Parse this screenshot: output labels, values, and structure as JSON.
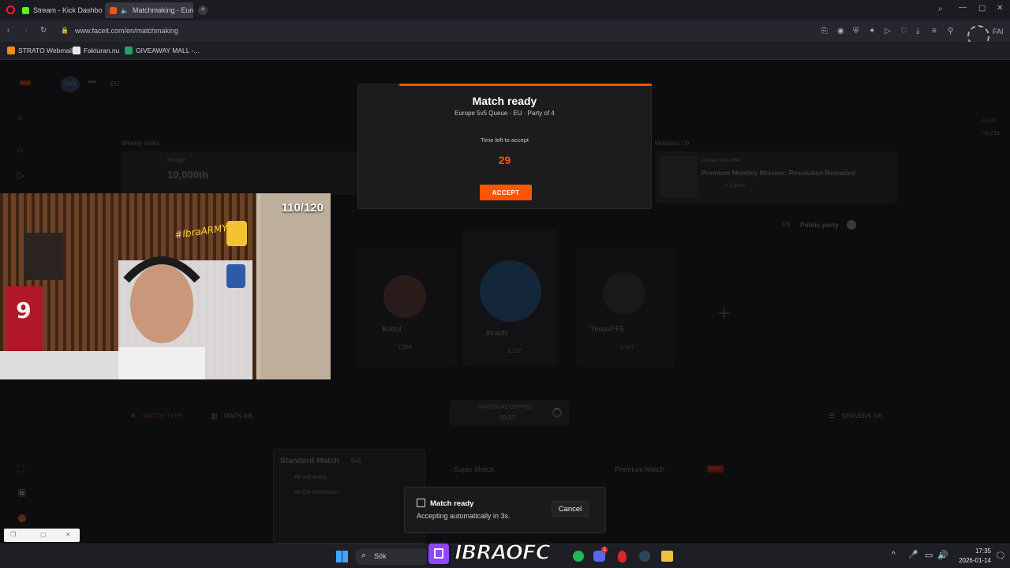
{
  "browser": {
    "tabs": [
      {
        "label": "Stream - Kick Dashboard",
        "favicon_color": "#53fc18",
        "active": false
      },
      {
        "label": "Matchmaking - Europ",
        "favicon_color": "#ff5500",
        "active": true
      }
    ],
    "url": "www.faceit.com/en/matchmaking",
    "profile_label": "FAI",
    "bookmarks": [
      {
        "label": "STRATO Webmail",
        "favicon_color": "#f08a24"
      },
      {
        "label": "Fakturan.nu",
        "favicon_color": "#e8e8e8"
      },
      {
        "label": "GIVEAWAY MALL -...",
        "favicon_color": "#1fa463"
      }
    ]
  },
  "page": {
    "header": {
      "region": "EU",
      "avatar_initials": "CAN"
    },
    "weekly_rank": {
      "label": "Weekly ranks",
      "sub": "Europe",
      "value": "10,000th"
    },
    "mission": {
      "label": "Missions (3)",
      "tag": "Limited time offer",
      "title": "Premium Monthly Mission: Resolution Reloaded",
      "reward": "+ 5 prize"
    },
    "party": {
      "count": "2/3",
      "label": "Public party"
    },
    "players": [
      {
        "name": "Battol",
        "elo": "1,558"
      },
      {
        "name": "ibraofc",
        "elo": "2,137"
      },
      {
        "name": "TrinaxFF5",
        "elo": "1,167"
      }
    ],
    "right_stats": [
      "-2,137",
      "+9,739"
    ],
    "bottom_tabs": {
      "match_type": "MATCH TYPE",
      "maps": "MAPS 8/8",
      "servers": "SERVERS 6/6"
    },
    "match_accepted": {
      "label": "MATCH ACCEPTED",
      "time": "00:27"
    },
    "modes": {
      "standard": {
        "title": "Standard Match",
        "size": "5v5",
        "line1": "All skill levels",
        "line2": "No Elo restrictions"
      },
      "super": {
        "title": "Super Match"
      },
      "premium": {
        "title": "Premium Match",
        "badge": "NEW"
      }
    }
  },
  "modal": {
    "title": "Match ready",
    "subtitle": "Europe 5v5 Queue · EU · Party of 4",
    "time_label": "Time left to accept",
    "countdown": "29",
    "accept_label": "ACCEPT"
  },
  "webcam": {
    "sub_count": "110/120"
  },
  "toast": {
    "title": "Match ready",
    "message": "Accepting automatically in 3s.",
    "cancel_label": "Cancel"
  },
  "taskbar": {
    "search_label": "Sök",
    "streamer_name": "IBRAOFC",
    "time": "17:35",
    "date": "2026-01-14",
    "notification_badge": "1"
  },
  "colors": {
    "accent": "#ff5500",
    "kick_green": "#53fc18",
    "twitch_purple": "#9146ff"
  }
}
